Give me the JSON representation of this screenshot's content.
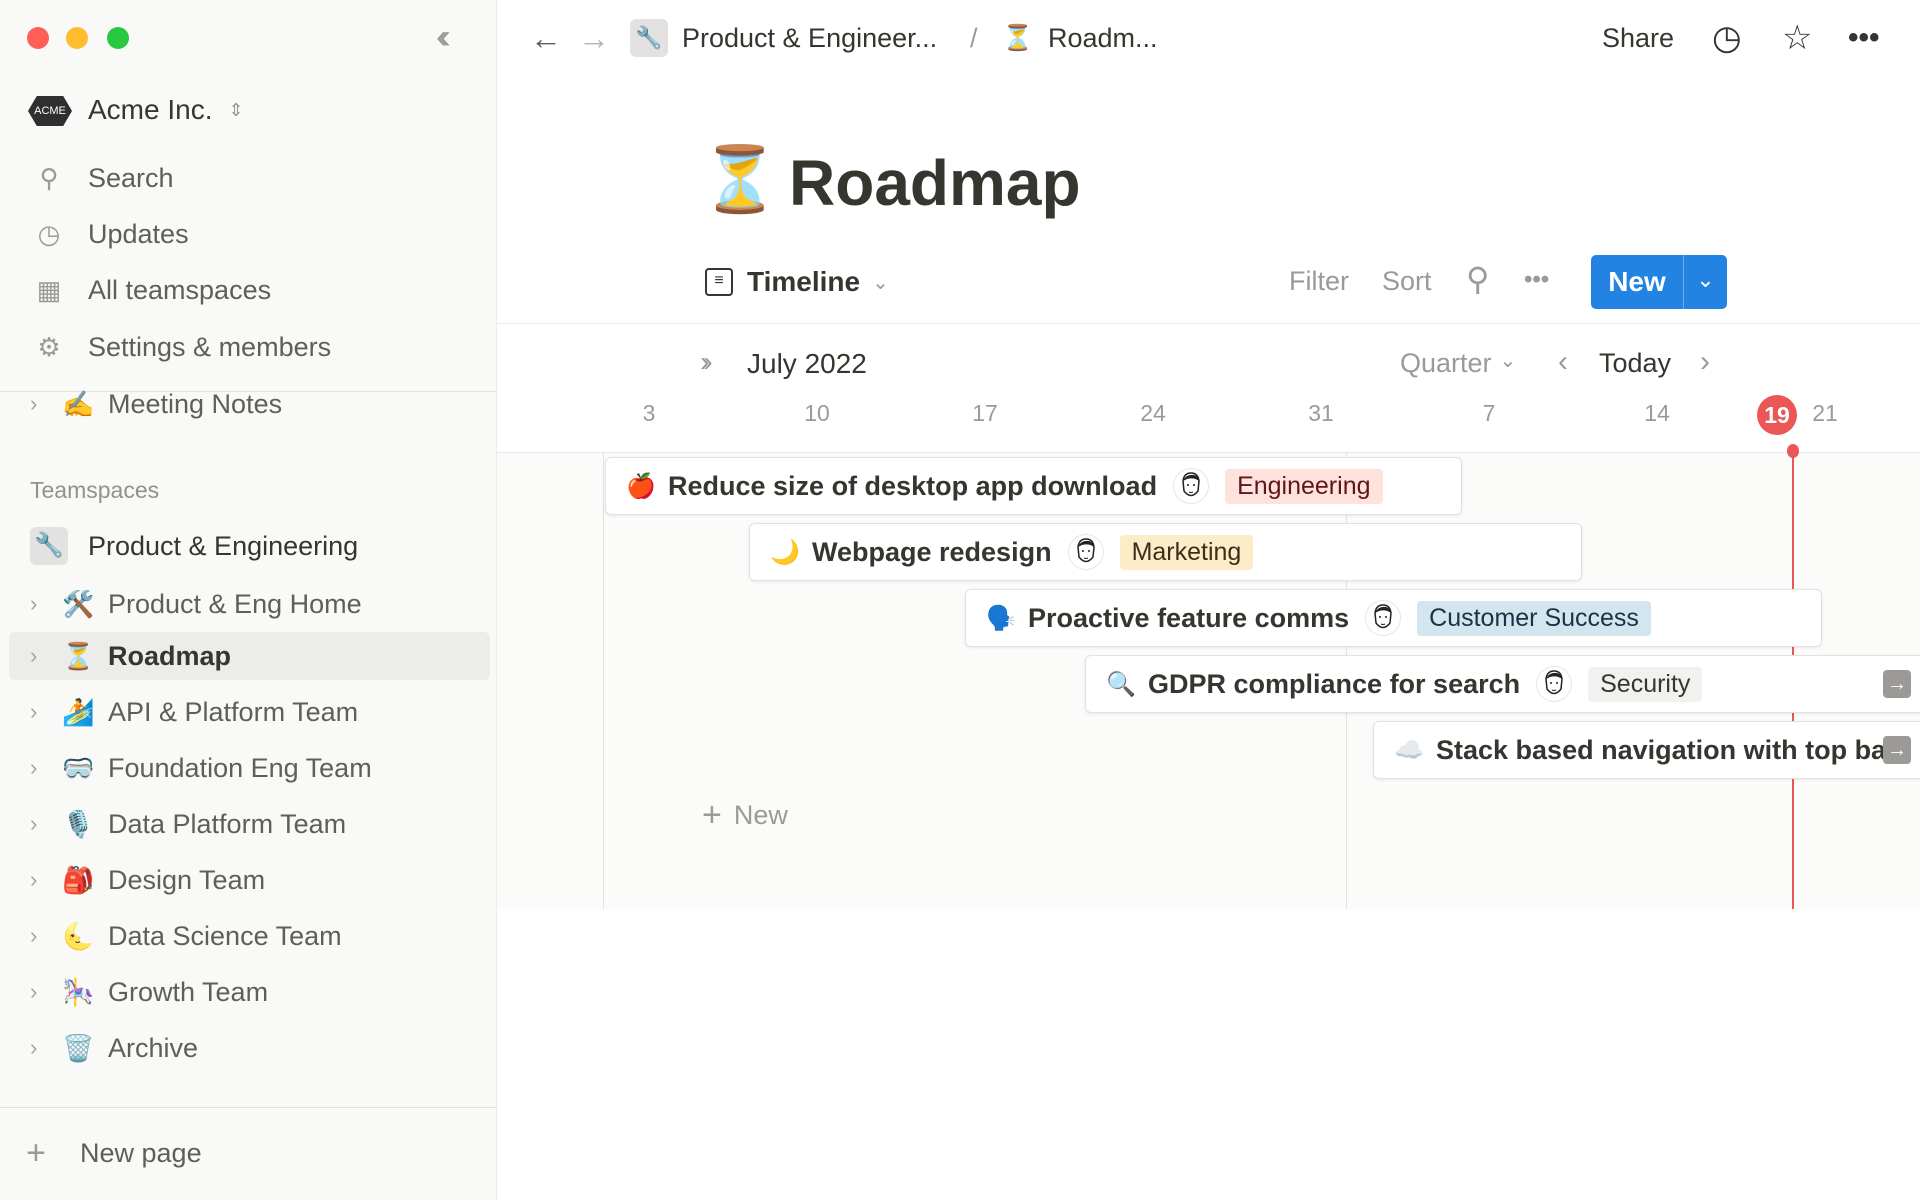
{
  "window": {
    "controls": [
      "close",
      "minimize",
      "maximize"
    ]
  },
  "sidebar": {
    "workspace": "Acme Inc.",
    "workspace_logo": "ACME",
    "nav": [
      {
        "label": "Search",
        "icon": "search-icon"
      },
      {
        "label": "Updates",
        "icon": "clock-icon"
      },
      {
        "label": "All teamspaces",
        "icon": "building-icon"
      },
      {
        "label": "Settings & members",
        "icon": "gear-icon"
      }
    ],
    "meeting_notes": {
      "label": "Meeting Notes",
      "emoji": "✍️"
    },
    "teamspaces_heading": "Teamspaces",
    "teamspace": {
      "label": "Product & Engineering",
      "icon": "wrench-icon"
    },
    "pages": [
      {
        "label": "Product & Eng Home",
        "emoji": "🛠️"
      },
      {
        "label": "Roadmap",
        "emoji": "⏳",
        "selected": true
      },
      {
        "label": "API & Platform Team",
        "emoji": "🏄"
      },
      {
        "label": "Foundation Eng Team",
        "emoji": "🥽"
      },
      {
        "label": "Data Platform Team",
        "emoji": "🎙️"
      },
      {
        "label": "Design Team",
        "emoji": "🎒"
      },
      {
        "label": "Data Science Team",
        "emoji": "🌜"
      },
      {
        "label": "Growth Team",
        "emoji": "🎠"
      },
      {
        "label": "Archive",
        "emoji": "🗑️"
      }
    ],
    "new_page": "New page"
  },
  "topbar": {
    "breadcrumb": [
      {
        "label": "Product & Engineer...",
        "icon": "wrench-icon"
      },
      {
        "label": "Roadm...",
        "emoji": "⏳"
      }
    ],
    "separator": "/",
    "share": "Share"
  },
  "page": {
    "emoji": "⏳",
    "title": "Roadmap"
  },
  "view": {
    "name": "Timeline",
    "filter": "Filter",
    "sort": "Sort",
    "new": "New",
    "accent": "#2383e2"
  },
  "timeline": {
    "month": "July 2022",
    "scale": "Quarter",
    "today_label": "Today",
    "days": [
      "3",
      "10",
      "17",
      "24",
      "31",
      "7",
      "14",
      "19",
      "21"
    ],
    "today": "19",
    "today_color": "#eb5757",
    "add_new": "New",
    "tasks": [
      {
        "title": "Reduce size of desktop app download",
        "emoji": "🍎",
        "tag": "Engineering",
        "tag_bg": "#ffe2dd",
        "tag_fg": "#5d1715",
        "start": "2022-07-01",
        "end": "2022-08-05"
      },
      {
        "title": "Webpage redesign",
        "emoji": "🌙",
        "tag": "Marketing",
        "tag_bg": "#fdecc8",
        "tag_fg": "#402c1b",
        "start": "2022-07-07",
        "end": "2022-08-10"
      },
      {
        "title": "Proactive feature comms",
        "emoji": "🗣️",
        "tag": "Customer Success",
        "tag_bg": "#d3e5ef",
        "tag_fg": "#183347",
        "start": "2022-07-16",
        "end": "2022-08-20"
      },
      {
        "title": "GDPR compliance for search",
        "emoji": "🔍",
        "tag": "Security",
        "tag_bg": "#f1f1ef",
        "tag_fg": "#37352f",
        "start": "2022-07-21"
      },
      {
        "title": "Stack based navigation with top bar",
        "emoji": "☁️",
        "start": "2022-08-02"
      }
    ]
  }
}
